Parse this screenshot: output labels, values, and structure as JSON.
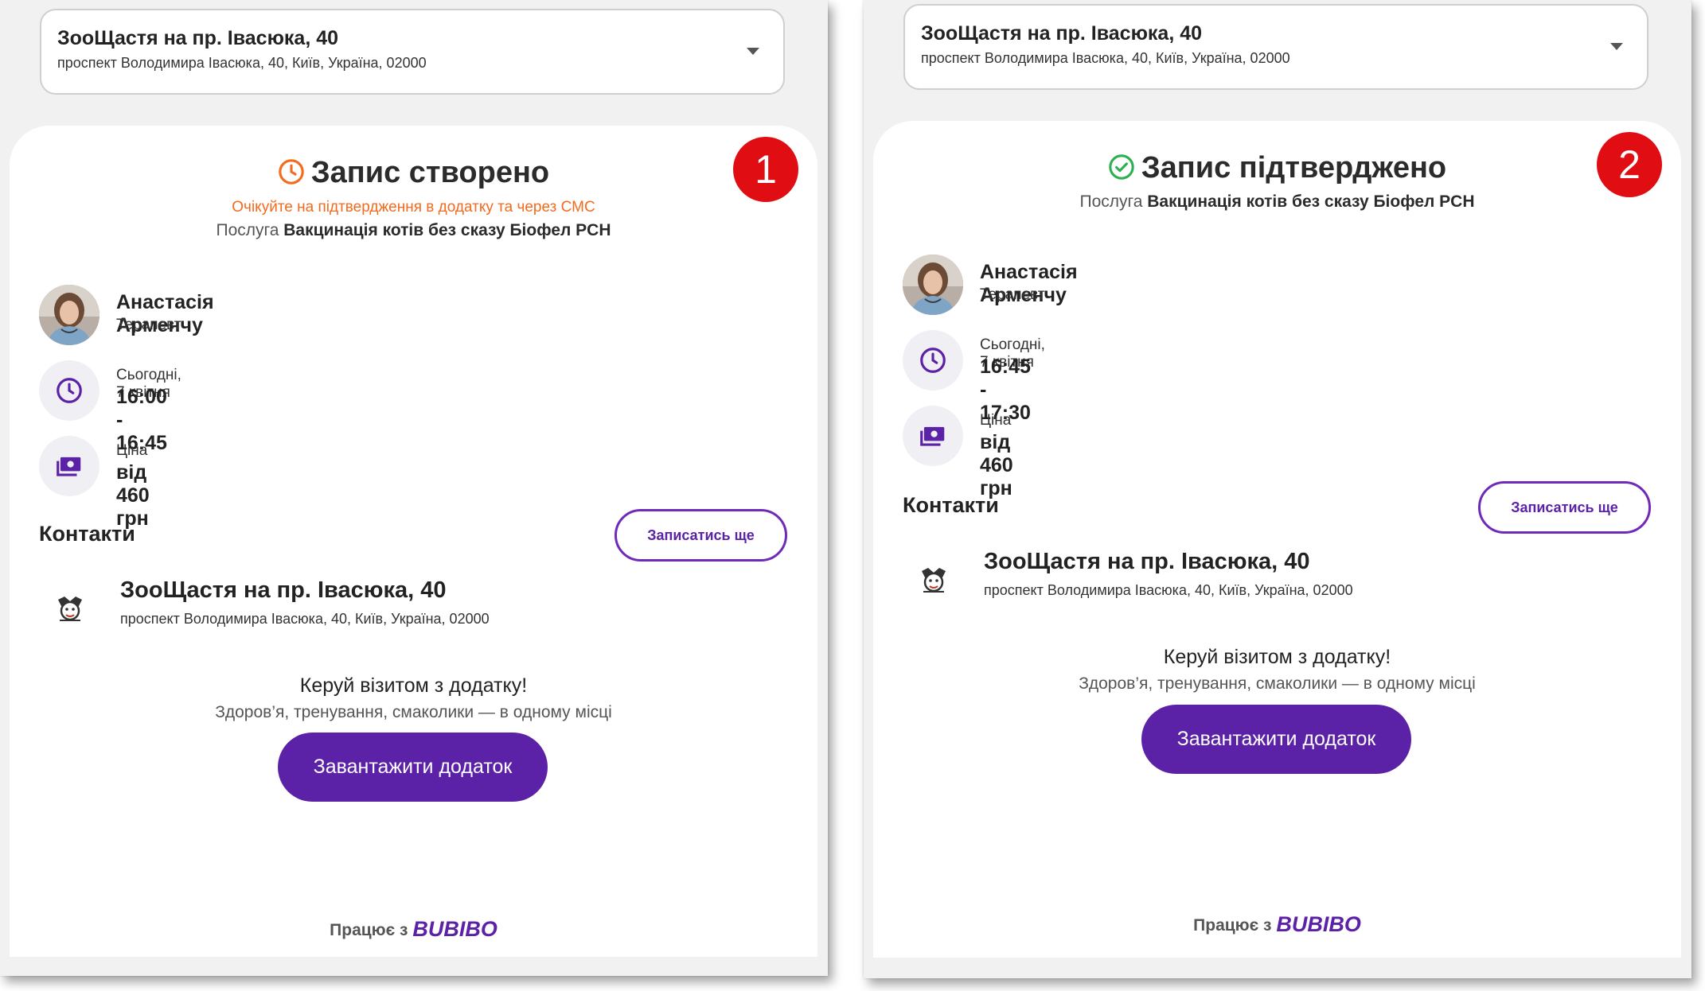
{
  "screens": [
    {
      "badge": "1",
      "selector": {
        "name": "ЗооЩастя на пр. Івасюка, 40",
        "address": "проспект Володимира Івасюка, 40, Київ, Україна, 02000"
      },
      "status_title": "Запис створено",
      "status_icon": "clock-icon",
      "status_color": "#f26b1f",
      "pending_note": "Очікуйте на підтвердження в додатку та через СМС",
      "service_label": "Послуга",
      "service_name": "Вакцинація котів без сказу Біофел PCH",
      "doctor": {
        "name": "Анастасія Арменчу",
        "role": "Терапевт"
      },
      "time": {
        "label": "Сьогодні, 7 квітня",
        "value": "16:00 - 16:45"
      },
      "price": {
        "label": "Ціна",
        "value": "від 460 грн"
      },
      "contacts_title": "Контакти",
      "book_again": "Записатись ще",
      "clinic": {
        "name": "ЗооЩастя на пр. Івасюка, 40",
        "address": "проспект Володимира Івасюка, 40, Київ, Україна, 02000"
      },
      "promo_title": "Керуй візитом з додатку!",
      "promo_sub": "Здоров’я, тренування, смаколики — в одному місці",
      "download": "Завантажити додаток",
      "powered_by": "Працює з",
      "brand": "BUBIBO"
    },
    {
      "badge": "2",
      "selector": {
        "name": "ЗооЩастя на пр. Івасюка, 40",
        "address": "проспект Володимира Івасюка, 40, Київ, Україна, 02000"
      },
      "status_title": "Запис підтверджено",
      "status_icon": "check-circle-icon",
      "status_color": "#2eaf52",
      "service_label": "Послуга",
      "service_name": "Вакцинація котів без сказу Біофел PCH",
      "doctor": {
        "name": "Анастасія Арменчу",
        "role": "Терапевт"
      },
      "time": {
        "label": "Сьогодні, 7 квітня",
        "value": "16:45 - 17:30"
      },
      "price": {
        "label": "Ціна",
        "value": "від 460 грн"
      },
      "contacts_title": "Контакти",
      "book_again": "Записатись ще",
      "clinic": {
        "name": "ЗооЩастя на пр. Івасюка, 40",
        "address": "проспект Володимира Івасюка, 40, Київ, Україна, 02000"
      },
      "promo_title": "Керуй візитом з додатку!",
      "promo_sub": "Здоров’я, тренування, смаколики — в одному місці",
      "download": "Завантажити додаток",
      "powered_by": "Працює з",
      "brand": "BUBIBO"
    }
  ],
  "colors": {
    "accent": "#5b21a6",
    "badge": "#e00d12"
  }
}
